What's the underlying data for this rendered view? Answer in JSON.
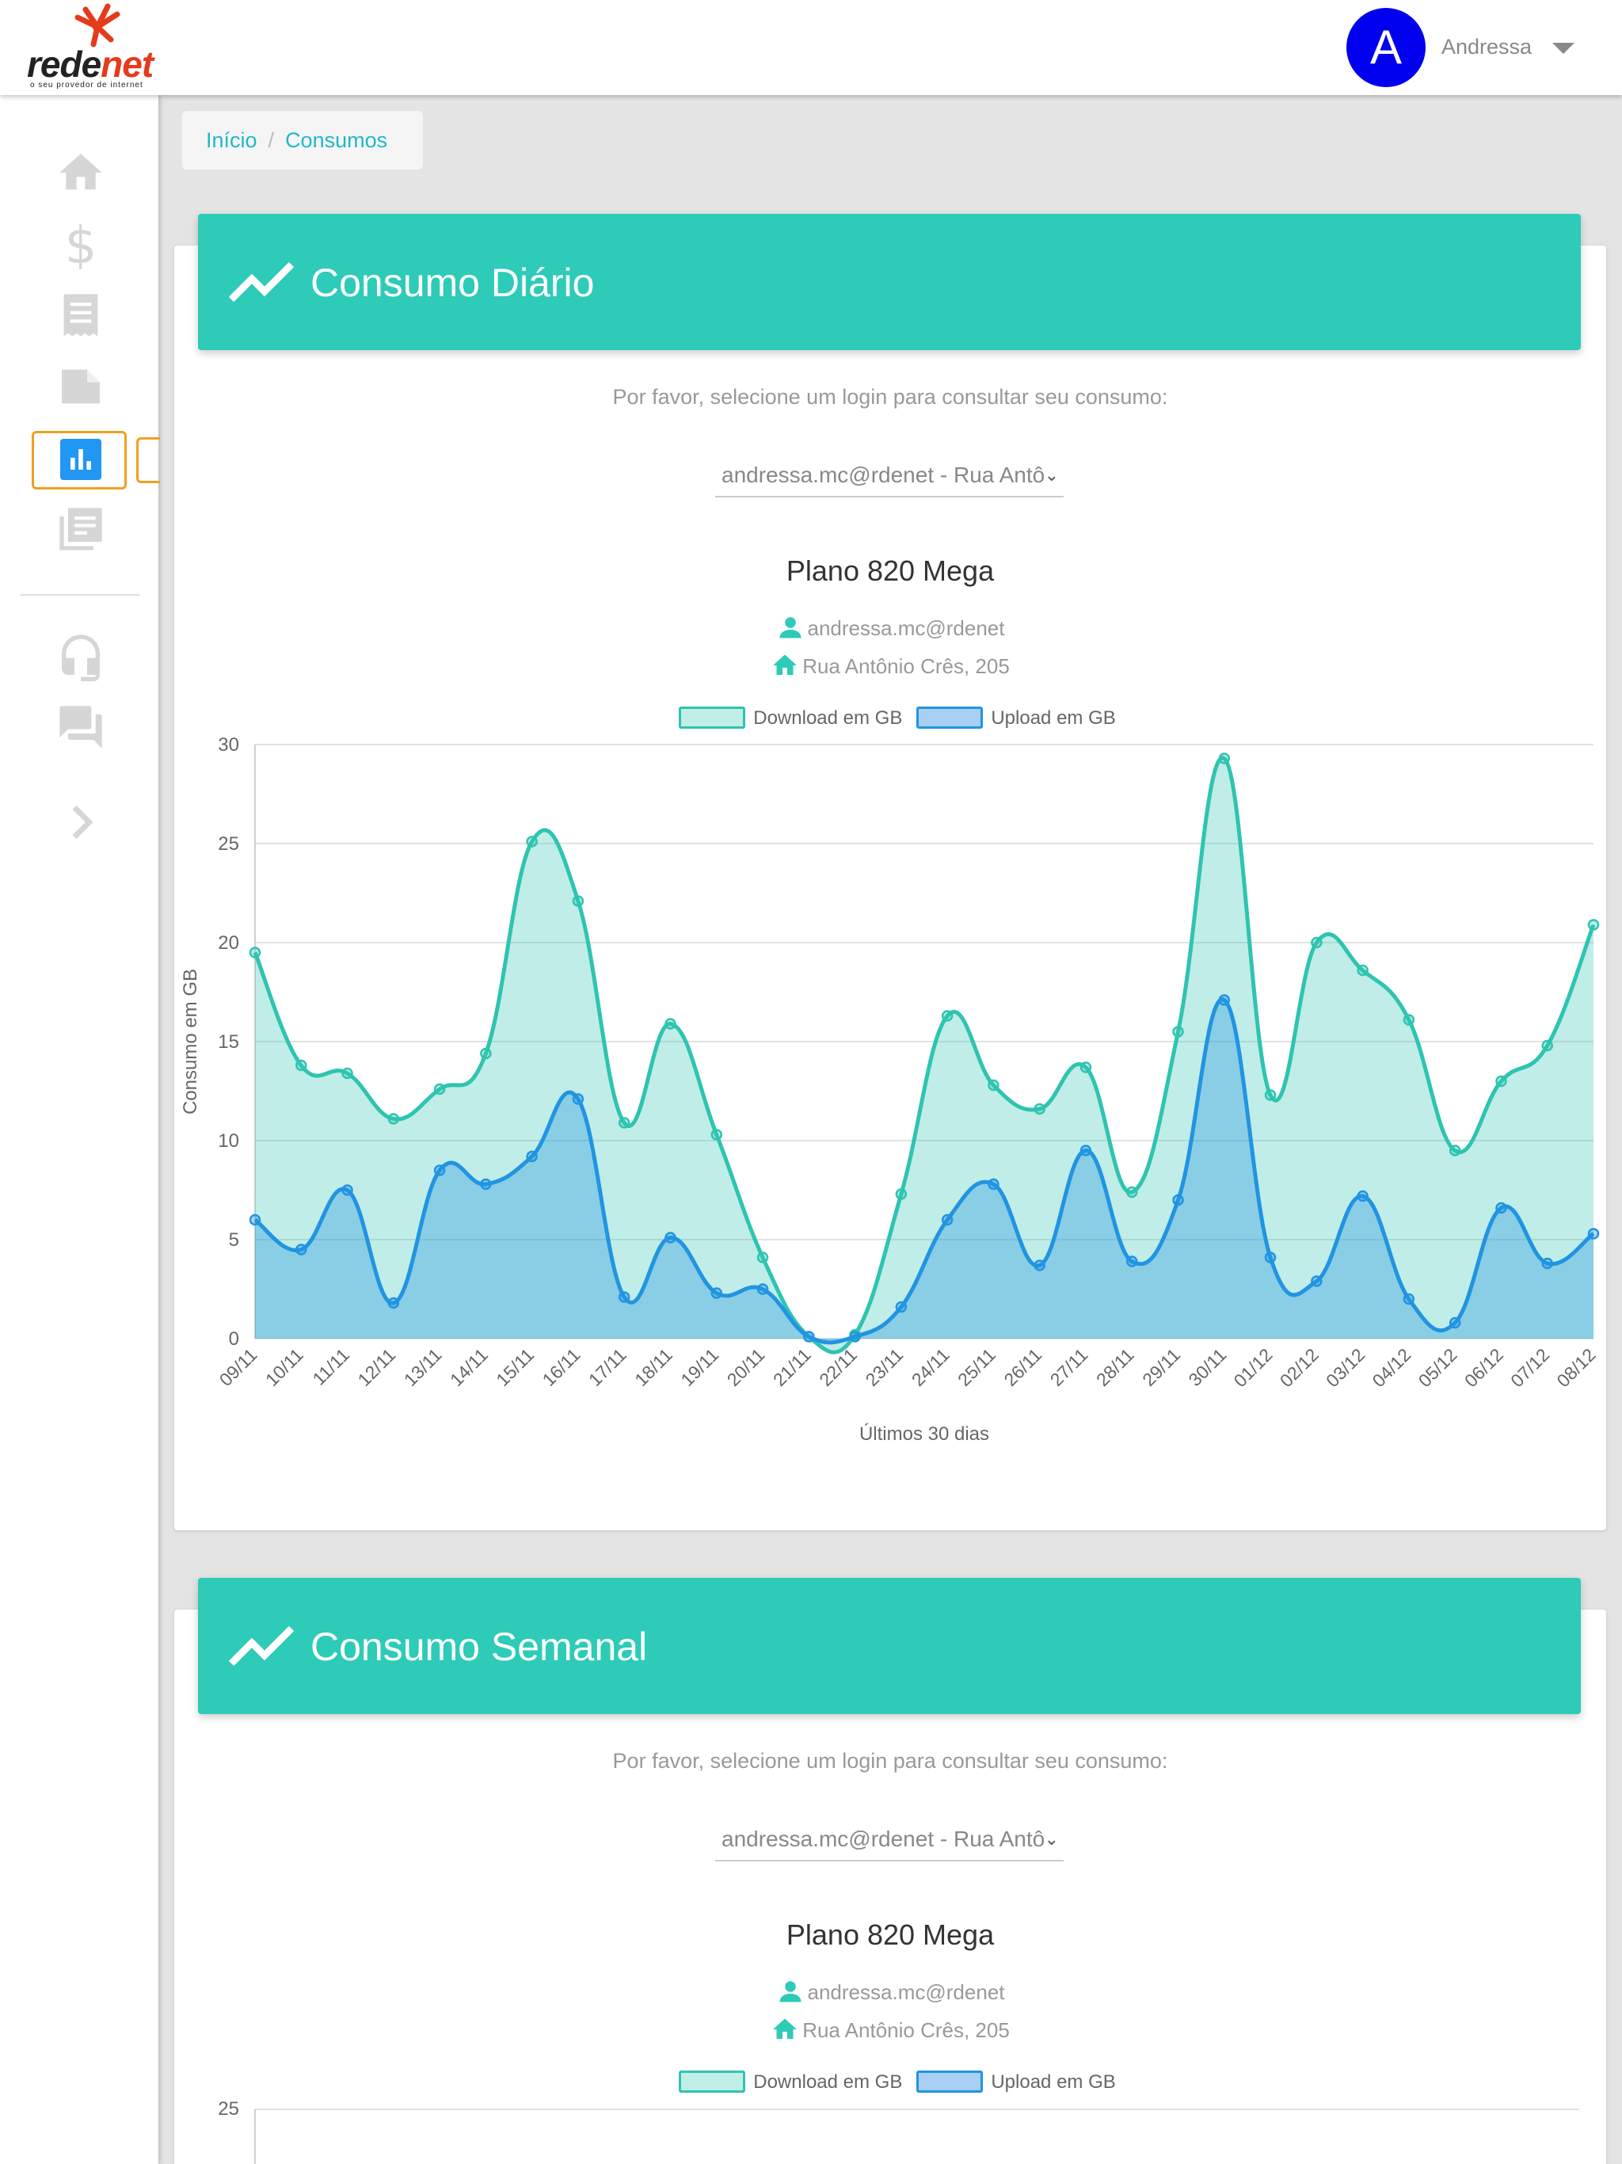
{
  "app": {
    "logo_left": "rede",
    "logo_right": "net",
    "logo_tagline": "o seu provedor de internet"
  },
  "user": {
    "initial": "A",
    "name": "Andressa"
  },
  "sidebar": {
    "icons": [
      "home-icon",
      "dollar-icon",
      "receipt-icon",
      "note-icon",
      "bar-chart-icon",
      "library-books-icon",
      "headset-icon",
      "forum-icon",
      "chevron-right-icon"
    ],
    "active": "bar-chart-icon"
  },
  "breadcrumb": {
    "home": "Início",
    "separator": "/",
    "current": "Consumos"
  },
  "colors": {
    "accent": "#2dcbb8",
    "download": "#2ec4b0",
    "upload": "#2194e2",
    "active_outline": "#f0a022"
  },
  "daily": {
    "title": "Consumo Diário",
    "prompt": "Por favor, selecione um login para consultar seu consumo:",
    "select_value": "andressa.mc@rdenet - Rua Antô",
    "plan": "Plano 820 Mega",
    "login": "andressa.mc@rdenet",
    "address": "Rua Antônio Crês, 205",
    "legend_download": "Download em GB",
    "legend_upload": "Upload em GB"
  },
  "weekly": {
    "title": "Consumo Semanal",
    "prompt": "Por favor, selecione um login para consultar seu consumo:",
    "select_value": "andressa.mc@rdenet - Rua Antô",
    "plan": "Plano 820 Mega",
    "login": "andressa.mc@rdenet",
    "address": "Rua Antônio Crês, 205",
    "legend_download": "Download em GB",
    "legend_upload": "Upload em GB",
    "first_tick": "25"
  },
  "chart_data": {
    "type": "area",
    "xlabel": "Últimos 30 dias",
    "ylabel": "Consumo em GB",
    "ylim": [
      0,
      30
    ],
    "yticks": [
      0,
      5,
      10,
      15,
      20,
      25,
      30
    ],
    "grid": true,
    "legend_position": "top-center",
    "x": [
      "09/11",
      "10/11",
      "11/11",
      "12/11",
      "13/11",
      "14/11",
      "15/11",
      "16/11",
      "17/11",
      "18/11",
      "19/11",
      "20/11",
      "21/11",
      "22/11",
      "23/11",
      "24/11",
      "25/11",
      "26/11",
      "27/11",
      "28/11",
      "29/11",
      "30/11",
      "01/12",
      "02/12",
      "03/12",
      "04/12",
      "05/12",
      "06/12",
      "07/12",
      "08/12"
    ],
    "series": [
      {
        "name": "Download em GB",
        "values": [
          19.5,
          13.8,
          13.4,
          11.1,
          12.6,
          14.4,
          25.1,
          22.1,
          10.9,
          15.9,
          10.3,
          4.1,
          0.1,
          0.2,
          7.3,
          16.3,
          12.8,
          11.6,
          13.7,
          7.4,
          15.5,
          29.3,
          12.3,
          20.0,
          18.6,
          16.1,
          9.5,
          13.0,
          14.8,
          20.9
        ]
      },
      {
        "name": "Upload em GB",
        "values": [
          6.0,
          4.5,
          7.5,
          1.8,
          8.5,
          7.8,
          9.2,
          12.1,
          2.1,
          5.1,
          2.3,
          2.5,
          0.1,
          0.1,
          1.6,
          6.0,
          7.8,
          3.7,
          9.5,
          3.9,
          7.0,
          17.1,
          4.1,
          2.9,
          7.2,
          2.0,
          0.8,
          6.6,
          3.8,
          5.3
        ]
      }
    ]
  }
}
